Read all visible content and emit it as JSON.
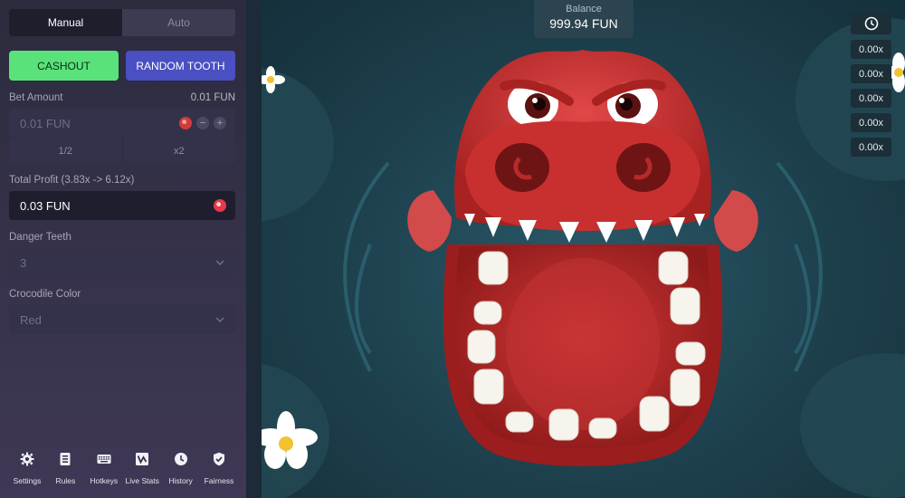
{
  "sidebar": {
    "tabs": [
      {
        "label": "Manual",
        "active": true
      },
      {
        "label": "Auto",
        "active": false
      }
    ],
    "cashout_label": "CASHOUT",
    "random_tooth_label": "RANDOM TOOTH",
    "bet": {
      "label": "Bet Amount",
      "right_value": "0.01 FUN",
      "input_value": "0.01 FUN",
      "half_label": "1/2",
      "double_label": "x2"
    },
    "profit": {
      "label": "Total Profit (3.83x -> 6.12x)",
      "value": "0.03 FUN"
    },
    "danger_teeth": {
      "label": "Danger Teeth",
      "value": "3"
    },
    "crocodile_color": {
      "label": "Crocodile Color",
      "value": "Red"
    },
    "footer": [
      {
        "label": "Settings",
        "icon": "gear-icon"
      },
      {
        "label": "Rules",
        "icon": "document-icon"
      },
      {
        "label": "Hotkeys",
        "icon": "keyboard-icon"
      },
      {
        "label": "Live Stats",
        "icon": "stats-icon"
      },
      {
        "label": "History",
        "icon": "clock-icon"
      },
      {
        "label": "Fairness",
        "icon": "shield-check-icon"
      }
    ]
  },
  "game": {
    "balance_label": "Balance",
    "balance_value": "999.94 FUN",
    "multipliers": [
      "0.00x",
      "0.00x",
      "0.00x",
      "0.00x",
      "0.00x"
    ]
  },
  "colors": {
    "cashout": "#59e27a",
    "random_tooth": "#4a4fc2",
    "crocodile": "#c8302f",
    "background": "#1d3f4c"
  }
}
